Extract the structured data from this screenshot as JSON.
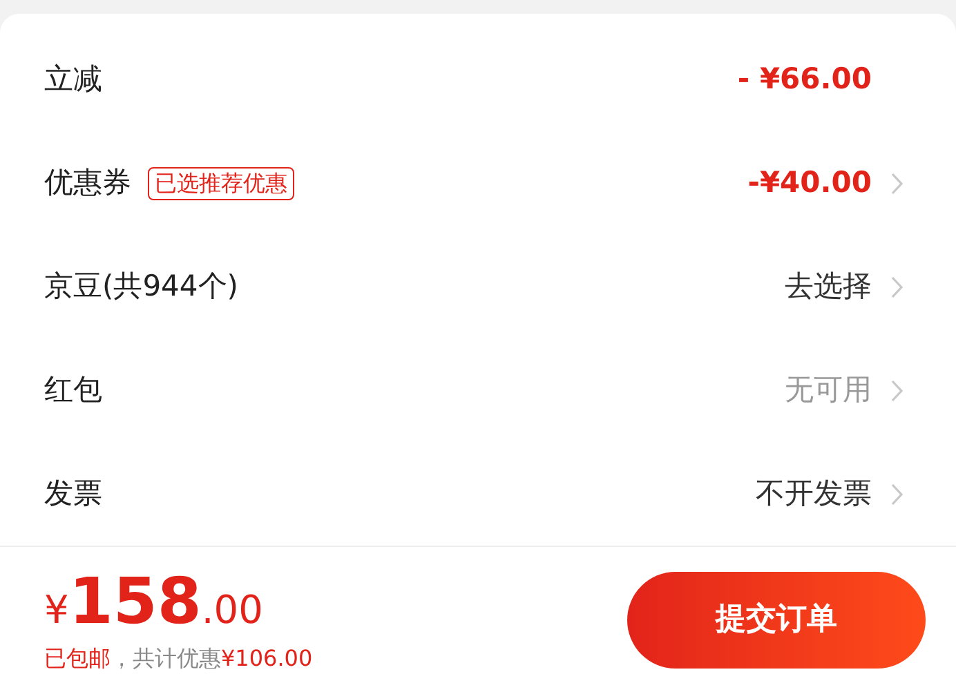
{
  "rows": [
    {
      "label": "立减",
      "value": "- ¥66.00",
      "kind": "discount",
      "has_arrow": false
    },
    {
      "label": "优惠券",
      "badge": "已选推荐优惠",
      "value": "-¥40.00",
      "kind": "discount",
      "has_arrow": true
    },
    {
      "label": "京豆(共944个)",
      "value": "去选择",
      "kind": "normal",
      "has_arrow": true
    },
    {
      "label": "红包",
      "value": "无可用",
      "kind": "muted",
      "has_arrow": true
    },
    {
      "label": "发票",
      "value": "不开发票",
      "kind": "normal",
      "has_arrow": true
    }
  ],
  "footer": {
    "currency": "¥",
    "price_int": "158",
    "price_dec": ".00",
    "shipping": "已包邮",
    "savings_label": "，共计优惠",
    "savings_amount": "¥106.00",
    "submit": "提交订单"
  }
}
